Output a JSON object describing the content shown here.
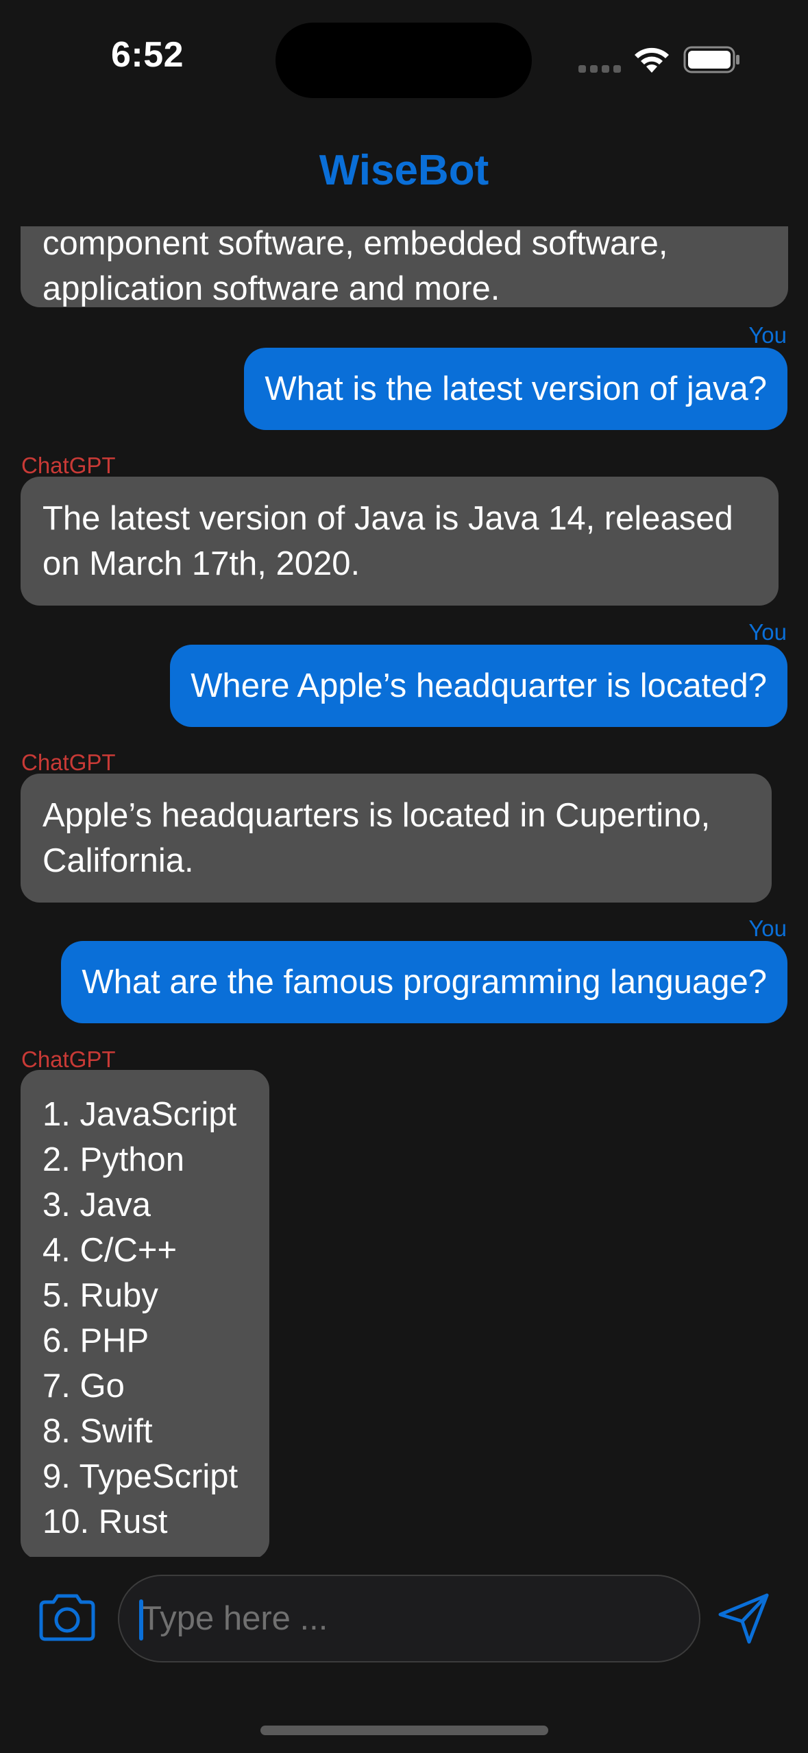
{
  "status_bar": {
    "time": "6:52"
  },
  "header": {
    "title": "WiseBot"
  },
  "labels": {
    "user": "You",
    "bot": "ChatGPT"
  },
  "messages": [
    {
      "role": "bot",
      "text": "component software, embedded software,\napplication software and more."
    },
    {
      "role": "user",
      "text": "What is the latest version of java?"
    },
    {
      "role": "bot",
      "text": "The latest version of Java is Java 14, released\non March 17th, 2020."
    },
    {
      "role": "user",
      "text": "Where Apple’s headquarter is located?"
    },
    {
      "role": "bot",
      "text": "Apple’s headquarters is located in Cupertino,\nCalifornia."
    },
    {
      "role": "user",
      "text": "What are the famous programming language?"
    },
    {
      "role": "bot",
      "text": "1. JavaScript\n2. Python\n3. Java\n4. C/C++\n5. Ruby\n6. PHP\n7. Go\n8. Swift\n9. TypeScript\n10. Rust"
    }
  ],
  "composer": {
    "placeholder": "Type here ...",
    "value": "",
    "camera_icon": "camera-icon",
    "send_icon": "paper-plane-icon"
  },
  "colors": {
    "background": "#151515",
    "accent": "#0a6fd8",
    "bot_bubble": "#505050",
    "bot_label": "#c93a36"
  }
}
